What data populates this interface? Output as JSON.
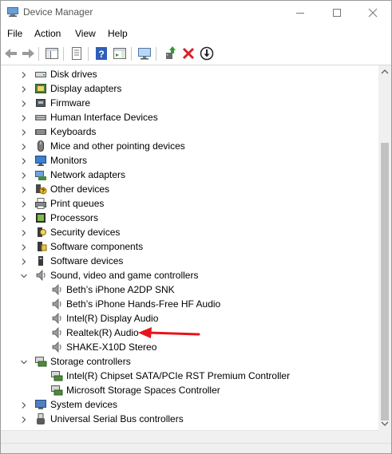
{
  "window": {
    "title": "Device Manager"
  },
  "menu": {
    "file": "File",
    "action": "Action",
    "view": "View",
    "help": "Help"
  },
  "tree": [
    {
      "label": "Disk drives",
      "icon": "disk-drive-icon",
      "expanded": false
    },
    {
      "label": "Display adapters",
      "icon": "display-adapter-icon",
      "expanded": false
    },
    {
      "label": "Firmware",
      "icon": "firmware-icon",
      "expanded": false
    },
    {
      "label": "Human Interface Devices",
      "icon": "hid-icon",
      "expanded": false
    },
    {
      "label": "Keyboards",
      "icon": "keyboard-icon",
      "expanded": false
    },
    {
      "label": "Mice and other pointing devices",
      "icon": "mouse-icon",
      "expanded": false
    },
    {
      "label": "Monitors",
      "icon": "monitor-icon",
      "expanded": false
    },
    {
      "label": "Network adapters",
      "icon": "network-adapter-icon",
      "expanded": false
    },
    {
      "label": "Other devices",
      "icon": "other-devices-icon",
      "expanded": false
    },
    {
      "label": "Print queues",
      "icon": "printer-icon",
      "expanded": false
    },
    {
      "label": "Processors",
      "icon": "processor-icon",
      "expanded": false
    },
    {
      "label": "Security devices",
      "icon": "security-device-icon",
      "expanded": false
    },
    {
      "label": "Software components",
      "icon": "software-component-icon",
      "expanded": false
    },
    {
      "label": "Software devices",
      "icon": "software-device-icon",
      "expanded": false
    },
    {
      "label": "Sound, video and game controllers",
      "icon": "speaker-icon",
      "expanded": true,
      "children": [
        {
          "label": "Beth’s iPhone A2DP SNK",
          "icon": "speaker-icon"
        },
        {
          "label": "Beth’s iPhone Hands-Free HF Audio",
          "icon": "speaker-icon"
        },
        {
          "label": "Intel(R) Display Audio",
          "icon": "speaker-icon"
        },
        {
          "label": "Realtek(R) Audio",
          "icon": "speaker-icon"
        },
        {
          "label": "SHAKE-X10D Stereo",
          "icon": "speaker-icon"
        }
      ]
    },
    {
      "label": "Storage controllers",
      "icon": "storage-controller-icon",
      "expanded": true,
      "children": [
        {
          "label": "Intel(R) Chipset SATA/PCIe RST Premium Controller",
          "icon": "storage-controller-icon"
        },
        {
          "label": "Microsoft Storage Spaces Controller",
          "icon": "storage-controller-icon"
        }
      ]
    },
    {
      "label": "System devices",
      "icon": "system-device-icon",
      "expanded": false
    },
    {
      "label": "Universal Serial Bus controllers",
      "icon": "usb-icon",
      "expanded": false
    }
  ],
  "annotation": {
    "color": "#e8141b",
    "target": "Realtek(R) Audio"
  }
}
